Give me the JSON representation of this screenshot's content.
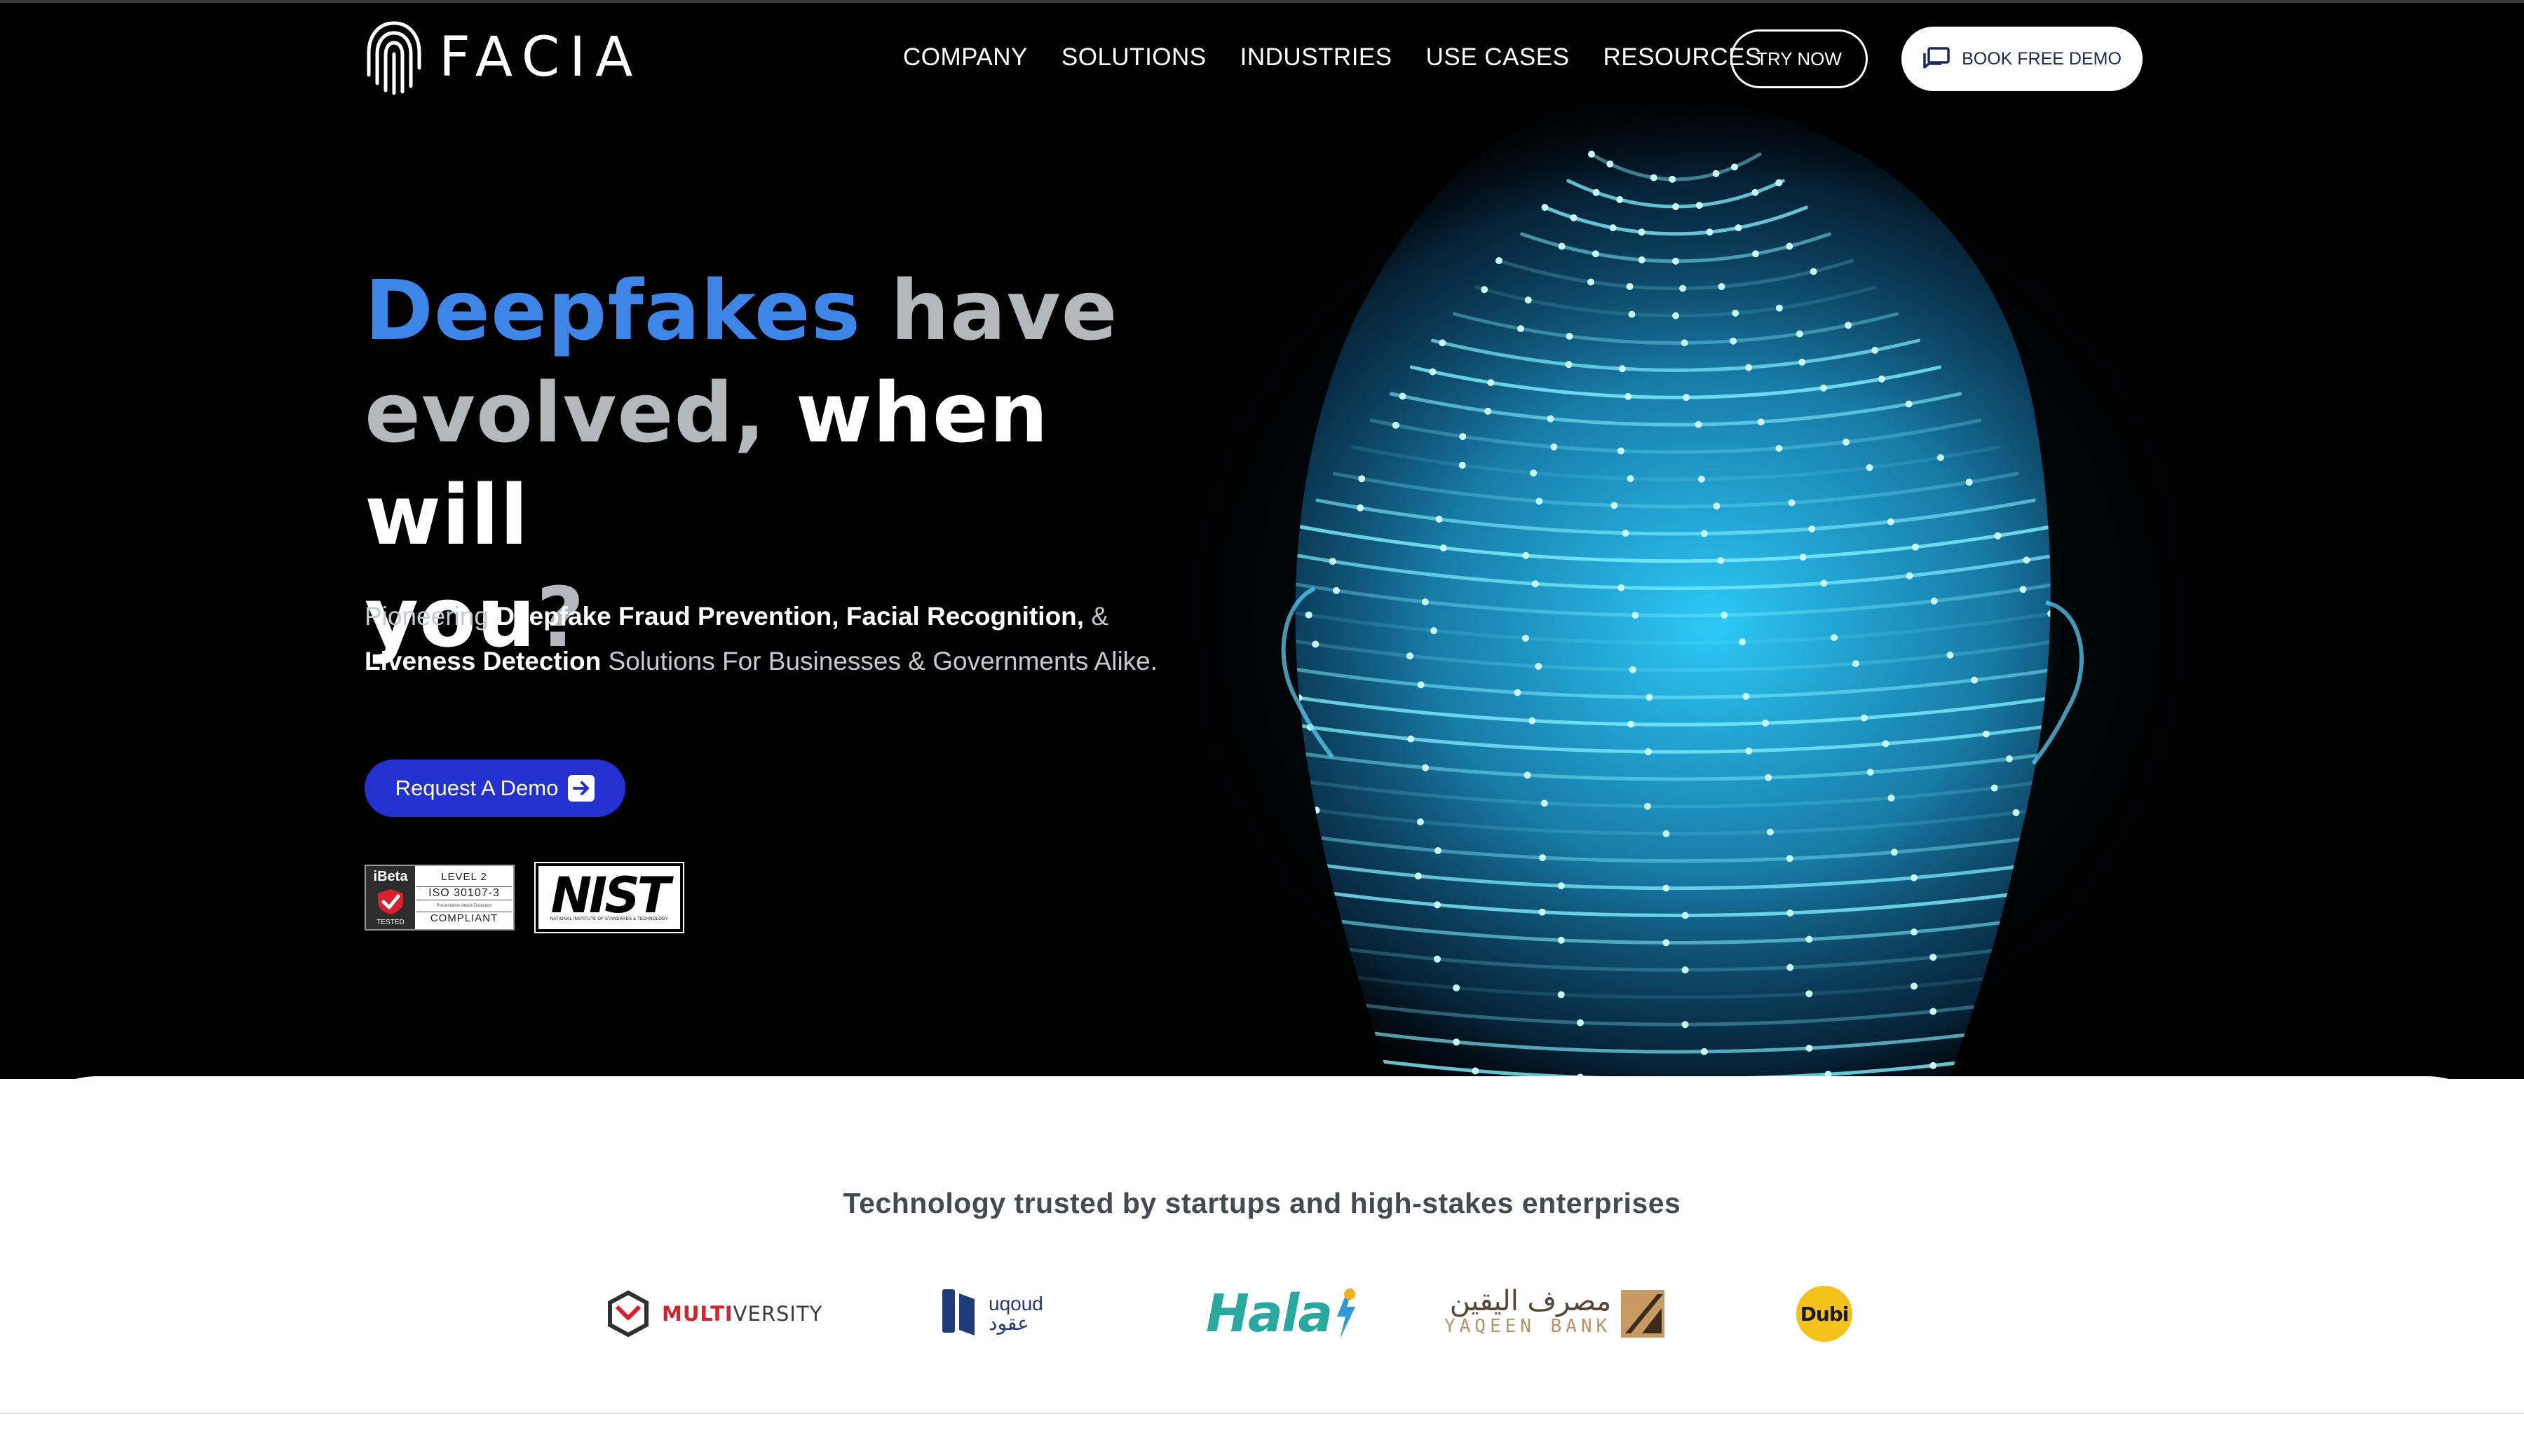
{
  "brand": {
    "name": "FACIA",
    "colors": {
      "accent_blue": "#3d86e8",
      "cta_blue": "#2331d1",
      "hero_bg": "#000000",
      "glow_cyan": "#4fd6ff"
    },
    "logo_icon": "fingerprint-icon"
  },
  "nav": {
    "items": [
      "COMPANY",
      "SOLUTIONS",
      "INDUSTRIES",
      "USE CASES",
      "RESOURCES"
    ],
    "try_now": "TRY NOW",
    "book_demo": "BOOK FREE DEMO",
    "book_demo_icon": "chat-icon"
  },
  "hero": {
    "headline": {
      "part1": "Deepfakes",
      "part2": " have",
      "part3": "evolved,",
      "part4": " when will",
      "part5": "you",
      "part6": "?"
    },
    "sub": {
      "t1": "Pioneering ",
      "b1": "Deepfake Fraud Prevention, Facial Recognition,",
      "t2": " & ",
      "b2": "Liveness Detection",
      "t3": " Solutions For Businesses & Governments Alike."
    },
    "cta": "Request A Demo",
    "cta_icon": "arrow-right-icon",
    "badges": {
      "ibeta": {
        "brand": "iBeta",
        "tested": "TESTED",
        "level": "LEVEL 2",
        "standard": "ISO 30107-3",
        "detail": "Presentation Attack Detection",
        "status": "COMPLIANT"
      },
      "nist": {
        "word": "NIST",
        "sub": "NATIONAL INSTITUTE OF STANDARDS & TECHNOLOGY"
      }
    }
  },
  "trusted": {
    "heading": "Technology trusted by startups and high-stakes enterprises",
    "clients": {
      "multiversity": {
        "red": "MULTI",
        "gray": "VERSITY"
      },
      "uqoud": {
        "en": "uqoud",
        "ar": "عقود"
      },
      "hala": {
        "text": "Hala"
      },
      "yaqeen": {
        "ar": "مصرف اليقين",
        "en": "YAQEEN BANK"
      },
      "dubi": {
        "text": "Dubi"
      }
    }
  }
}
